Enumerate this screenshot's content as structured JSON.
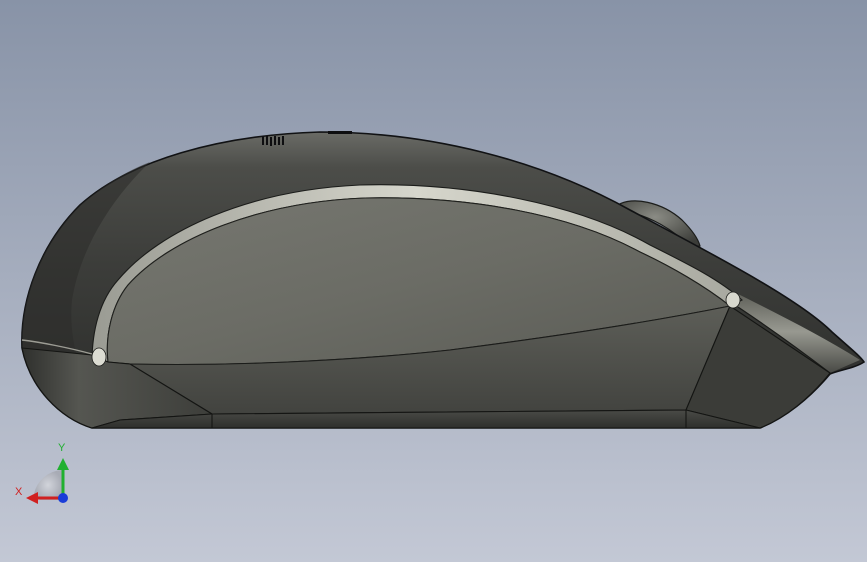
{
  "viewport": {
    "background_top": "#8893a7",
    "background_bottom": "#c3c8d5"
  },
  "model": {
    "name": "mouse",
    "body_color": "#4a4b47",
    "side_panel_color": "#6c6d66",
    "highlight_color": "#c9c9bf",
    "edge_color": "#15161a",
    "scroll_wheel_color": "#5a5b57"
  },
  "triad": {
    "x_label": "X",
    "y_label": "Y",
    "x_color": "#d02020",
    "y_color": "#20b030",
    "z_color": "#1a3dd8"
  }
}
